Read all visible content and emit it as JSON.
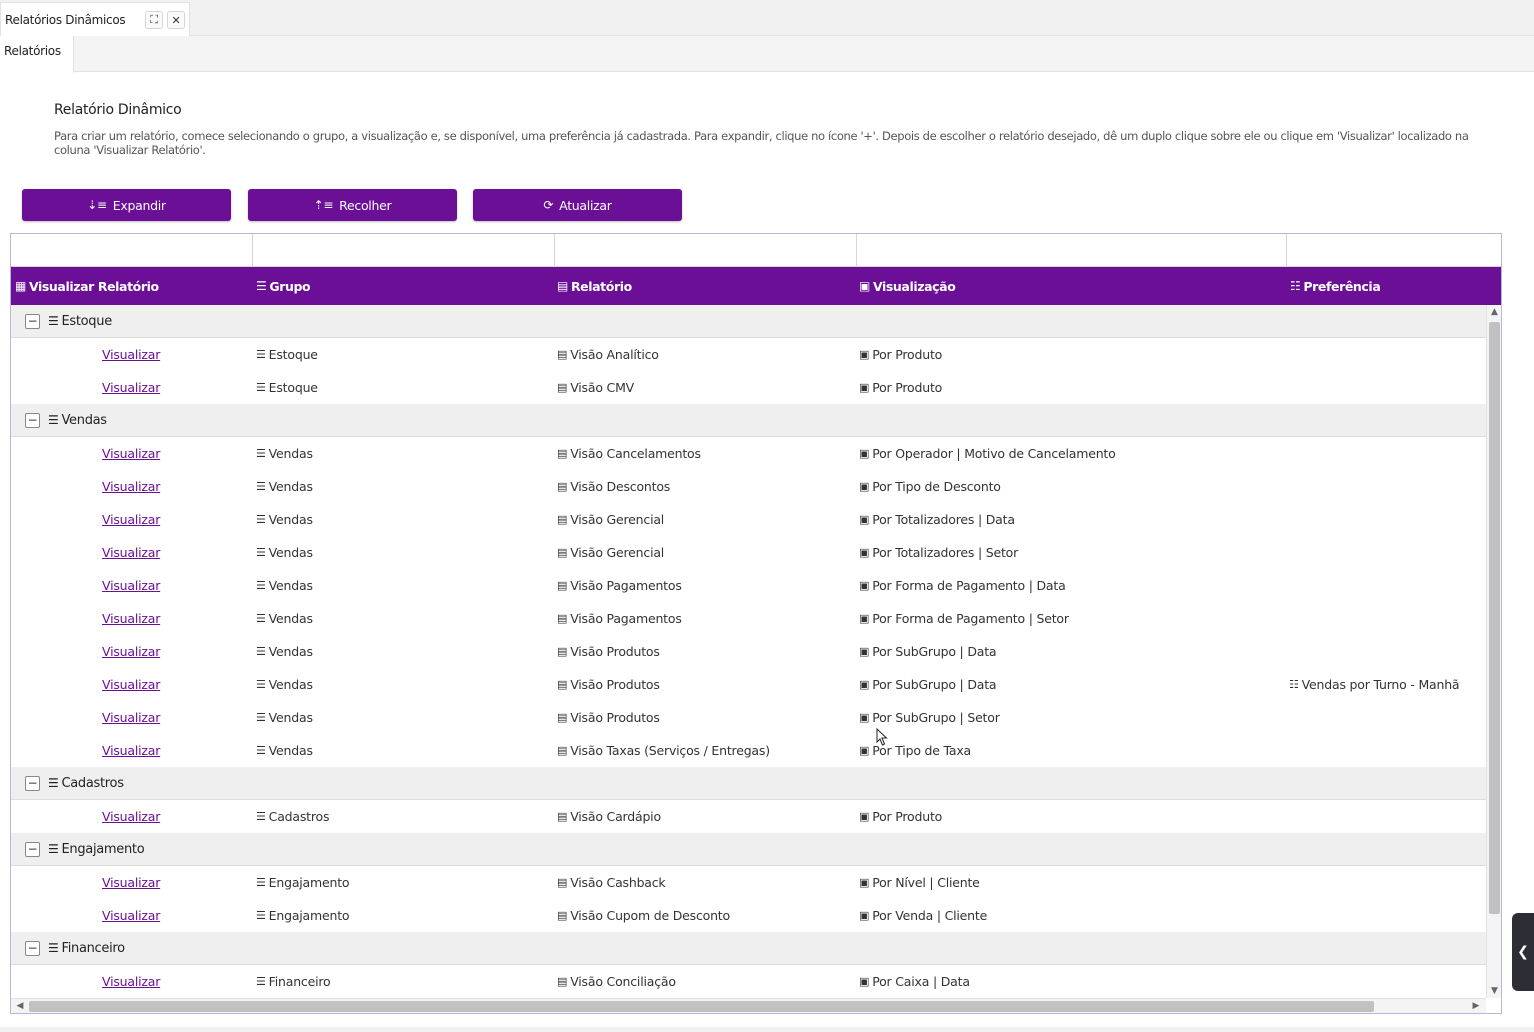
{
  "tab": {
    "title": "Relatórios Dinâmicos",
    "expand_icon": "⛶",
    "close_icon": "✕"
  },
  "subtab": {
    "label": "Relatórios"
  },
  "page": {
    "title": "Relatório Dinâmico",
    "description": "Para criar um relatório, comece selecionando o grupo, a visualização e, se disponível, uma preferência já cadastrada. Para expandir, clique no ícone '+'. Depois de escolher o relatório desejado, dê um duplo clique sobre ele ou clique em 'Visualizar' localizado na coluna 'Visualizar Relatório'."
  },
  "toolbar": {
    "expand_label": "Expandir",
    "collapse_label": "Recolher",
    "refresh_label": "Atualizar"
  },
  "columns": {
    "view_report": "Visualizar Relatório",
    "group": "Grupo",
    "report": "Relatório",
    "visualization": "Visualização",
    "preference": "Preferência"
  },
  "groups": [
    {
      "name": "Estoque",
      "toggle": "−",
      "rows": [
        {
          "link": "Visualizar",
          "group": "Estoque",
          "report": "Visão Analítico",
          "visualization": "Por Produto",
          "preference": ""
        },
        {
          "link": "Visualizar",
          "group": "Estoque",
          "report": "Visão CMV",
          "visualization": "Por Produto",
          "preference": ""
        }
      ]
    },
    {
      "name": "Vendas",
      "toggle": "−",
      "rows": [
        {
          "link": "Visualizar",
          "group": "Vendas",
          "report": "Visão Cancelamentos",
          "visualization": "Por Operador | Motivo de Cancelamento",
          "preference": ""
        },
        {
          "link": "Visualizar",
          "group": "Vendas",
          "report": "Visão Descontos",
          "visualization": "Por Tipo de Desconto",
          "preference": ""
        },
        {
          "link": "Visualizar",
          "group": "Vendas",
          "report": "Visão Gerencial",
          "visualization": "Por Totalizadores | Data",
          "preference": ""
        },
        {
          "link": "Visualizar",
          "group": "Vendas",
          "report": "Visão Gerencial",
          "visualization": "Por Totalizadores | Setor",
          "preference": ""
        },
        {
          "link": "Visualizar",
          "group": "Vendas",
          "report": "Visão Pagamentos",
          "visualization": "Por Forma de Pagamento | Data",
          "preference": ""
        },
        {
          "link": "Visualizar",
          "group": "Vendas",
          "report": "Visão Pagamentos",
          "visualization": "Por Forma de Pagamento | Setor",
          "preference": ""
        },
        {
          "link": "Visualizar",
          "group": "Vendas",
          "report": "Visão Produtos",
          "visualization": "Por SubGrupo | Data",
          "preference": ""
        },
        {
          "link": "Visualizar",
          "group": "Vendas",
          "report": "Visão Produtos",
          "visualization": "Por SubGrupo | Data",
          "preference": "Vendas por Turno - Manhã"
        },
        {
          "link": "Visualizar",
          "group": "Vendas",
          "report": "Visão Produtos",
          "visualization": "Por SubGrupo | Setor",
          "preference": ""
        },
        {
          "link": "Visualizar",
          "group": "Vendas",
          "report": "Visão Taxas (Serviços / Entregas)",
          "visualization": "Por Tipo de Taxa",
          "preference": ""
        }
      ]
    },
    {
      "name": "Cadastros",
      "toggle": "−",
      "rows": [
        {
          "link": "Visualizar",
          "group": "Cadastros",
          "report": "Visão Cardápio",
          "visualization": "Por Produto",
          "preference": ""
        }
      ]
    },
    {
      "name": "Engajamento",
      "toggle": "−",
      "rows": [
        {
          "link": "Visualizar",
          "group": "Engajamento",
          "report": "Visão Cashback",
          "visualization": "Por Nível | Cliente",
          "preference": ""
        },
        {
          "link": "Visualizar",
          "group": "Engajamento",
          "report": "Visão Cupom de Desconto",
          "visualization": "Por Venda | Cliente",
          "preference": ""
        }
      ]
    },
    {
      "name": "Financeiro",
      "toggle": "−",
      "rows": [
        {
          "link": "Visualizar",
          "group": "Financeiro",
          "report": "Visão Conciliação",
          "visualization": "Por Caixa | Data",
          "preference": ""
        }
      ]
    }
  ],
  "colors": {
    "accent": "#6a0f96",
    "group_bg": "#efefef"
  }
}
